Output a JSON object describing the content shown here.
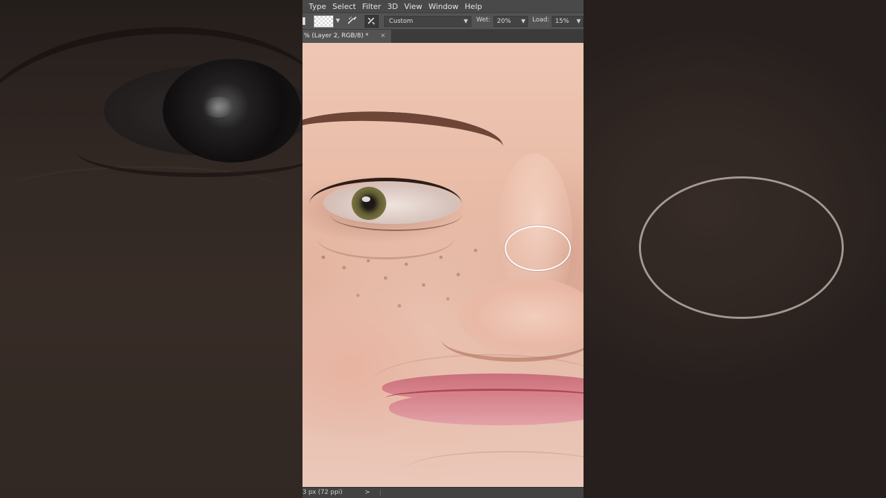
{
  "menu": {
    "items": [
      "Type",
      "Select",
      "Filter",
      "3D",
      "View",
      "Window",
      "Help"
    ]
  },
  "options_bar": {
    "brush_preset": "Custom",
    "wet_label": "Wet:",
    "wet_value": "20%",
    "load_label": "Load:",
    "load_value": "15%"
  },
  "document_tab": {
    "title": "% (Layer 2, RGB/8) *",
    "close_glyph": "×"
  },
  "status_bar": {
    "info": "3 px (72 ppi)",
    "arrow_glyph": ">"
  },
  "colors": {
    "menubar_bg": "#494949",
    "panel_bg": "#535353",
    "tab_strip_bg": "#3b3b3b",
    "lip_color": "#d47e88",
    "brush_cursor": "#ffffff"
  },
  "icons": {
    "edge_tool": "tool-preset-edge-icon",
    "swatch": "brush-swatch-icon",
    "dropdown": "chevron-down-icon",
    "clean_brush": "clean-brush-icon",
    "mix_brush": "mix-brush-icon",
    "close": "close-icon",
    "status_arrow": "chevron-right-icon"
  }
}
